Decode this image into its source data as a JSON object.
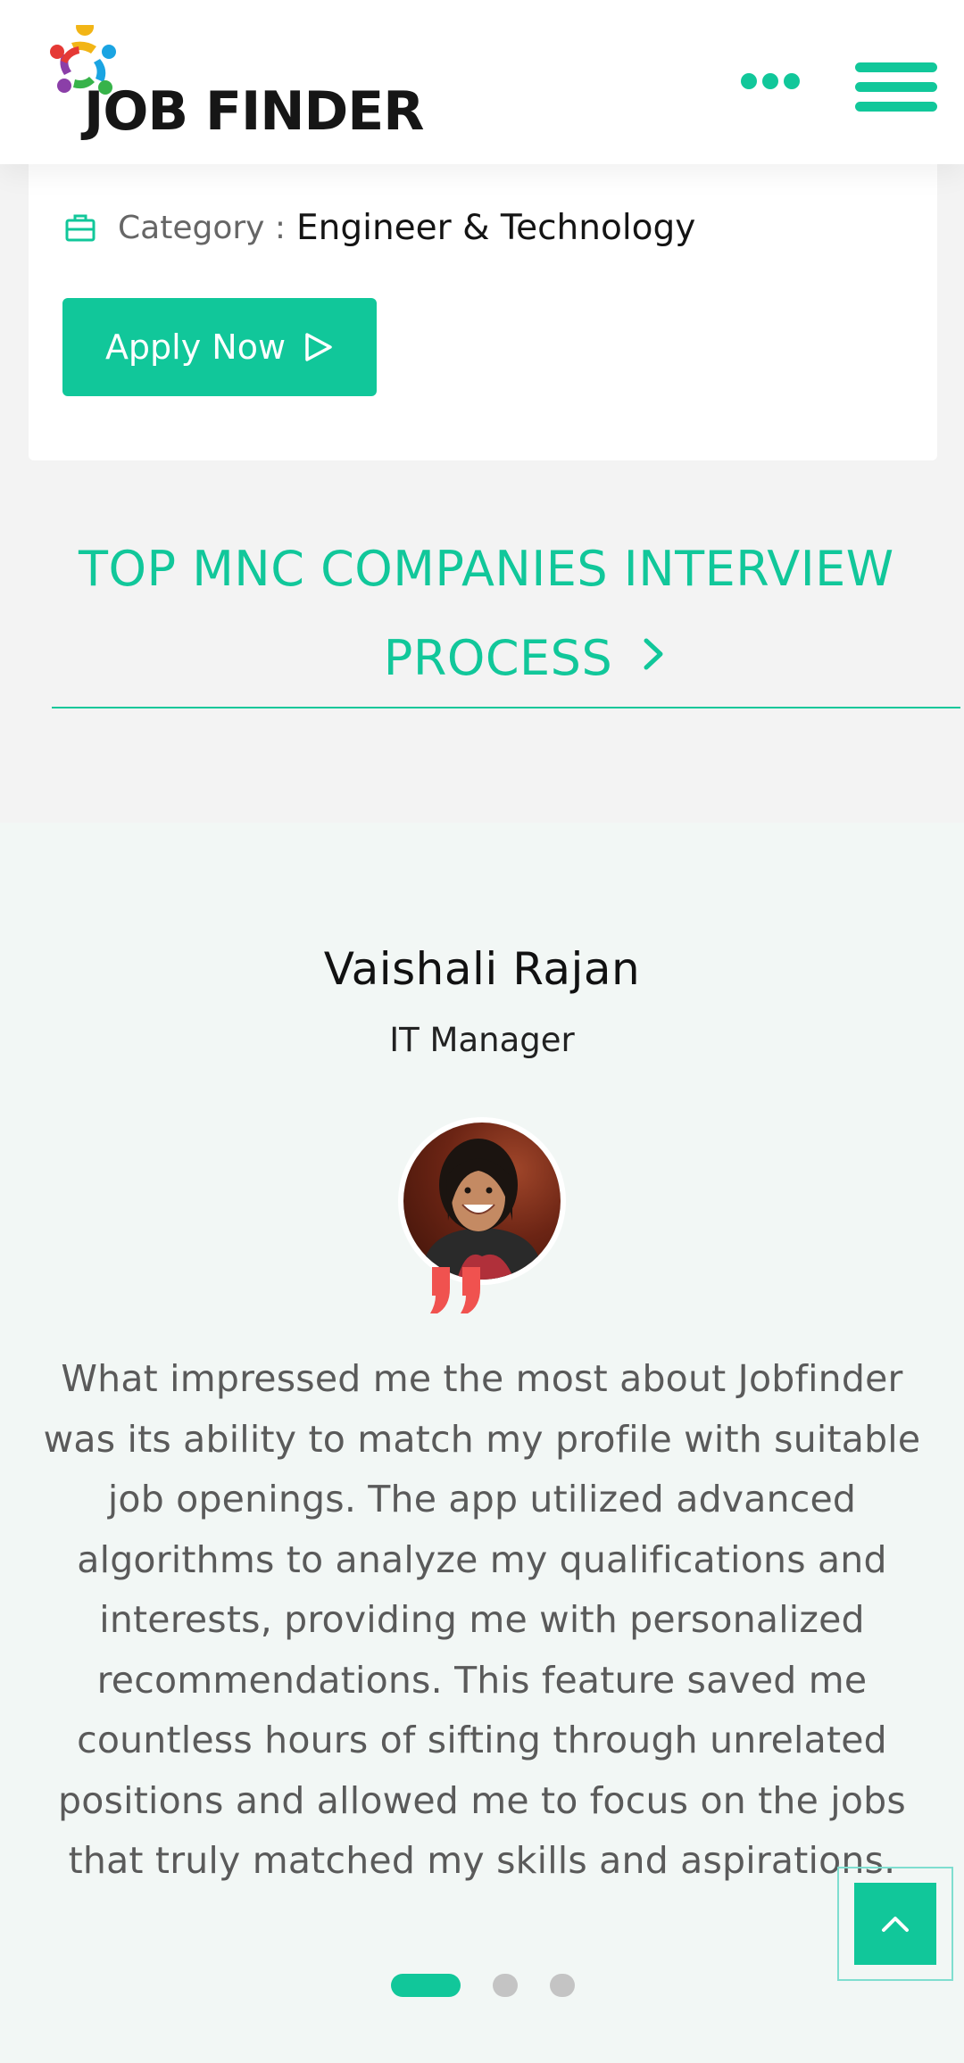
{
  "header": {
    "brand": "JOB FINDER",
    "logo_icon": "colorful-people-circle-logo",
    "more_icon": "three-dots-icon",
    "menu_icon": "hamburger-menu-icon"
  },
  "job_card": {
    "category_label": "Category :",
    "category_value": "Engineer & Technology",
    "apply_label": "Apply Now"
  },
  "mnc": {
    "line1": "TOP MNC COMPANIES INTERVIEW",
    "line2": "PROCESS"
  },
  "testimonial": {
    "name": "Vaishali Rajan",
    "role": "IT Manager",
    "text": "What impressed me the most about Jobfinder was its ability to match my profile with suitable job openings. The app utilized advanced algorithms to analyze my qualifications and interests, providing me with personalized recommendations. This feature saved me countless hours of sifting through unrelated positions and allowed me to focus on the jobs that truly matched my skills and aspirations.",
    "slides_total": 3,
    "active_slide": 1
  },
  "colors": {
    "accent": "#11c79a",
    "quote": "#f0524f",
    "section_bg": "#f2f7f5",
    "page_bg": "#f3f3f3"
  }
}
